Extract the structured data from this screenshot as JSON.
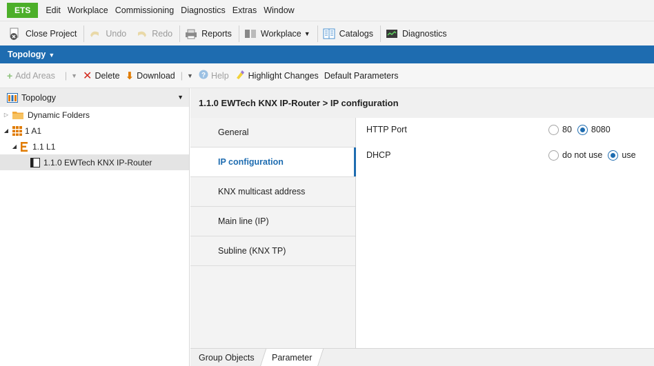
{
  "menu": {
    "brand": "ETS",
    "items": [
      "Edit",
      "Workplace",
      "Commissioning",
      "Diagnostics",
      "Extras",
      "Window"
    ]
  },
  "toolbar": {
    "close_project": "Close Project",
    "undo": "Undo",
    "redo": "Redo",
    "reports": "Reports",
    "workplace": "Workplace",
    "catalogs": "Catalogs",
    "diagnostics": "Diagnostics"
  },
  "band": {
    "title": "Topology"
  },
  "actions": {
    "add_areas": "Add Areas",
    "delete": "Delete",
    "download": "Download",
    "help": "Help",
    "highlight": "Highlight Changes",
    "default_params": "Default Parameters"
  },
  "tree": {
    "header": "Topology",
    "items": [
      {
        "label": "Dynamic Folders"
      },
      {
        "label": "1 A1"
      },
      {
        "label": "1.1 L1"
      },
      {
        "label": "1.1.0 EWTech KNX IP-Router"
      }
    ]
  },
  "detail": {
    "title": "1.1.0 EWTech KNX IP-Router > IP configuration",
    "tabs": [
      {
        "label": "General"
      },
      {
        "label": "IP configuration"
      },
      {
        "label": "KNX multicast address"
      },
      {
        "label": "Main line (IP)"
      },
      {
        "label": "Subline (KNX TP)"
      }
    ],
    "params": [
      {
        "label": "HTTP Port",
        "options": [
          "80",
          "8080"
        ],
        "selected": "8080"
      },
      {
        "label": "DHCP",
        "options": [
          "do not use",
          "use"
        ],
        "selected": "use"
      }
    ]
  },
  "bottom_tabs": [
    "Group Objects",
    "Parameter"
  ],
  "colors": {
    "accent": "#1e6cb0",
    "brand": "#4caf29",
    "delete": "#d22a1e",
    "download": "#e07b00"
  }
}
